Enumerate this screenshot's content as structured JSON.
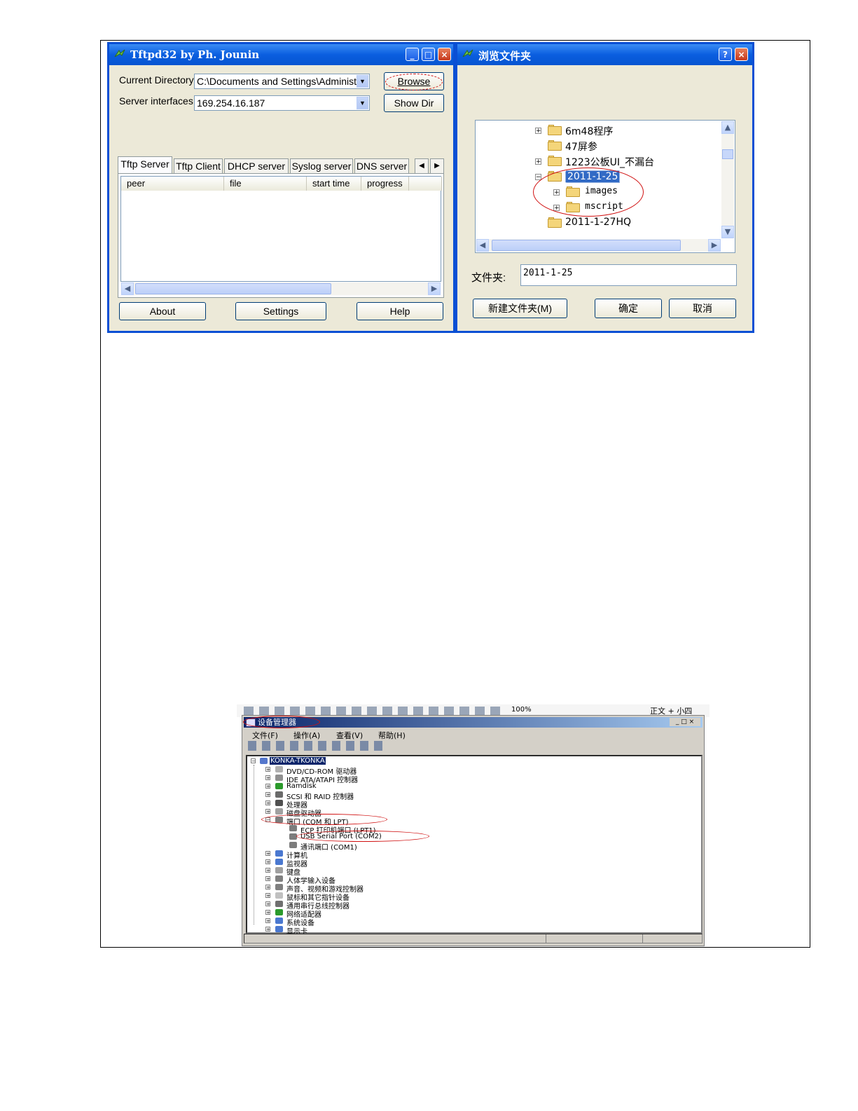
{
  "tftpd": {
    "title": "Tftpd32 by Ph. Jounin",
    "current_directory_label": "Current Directory",
    "current_directory_value": "C:\\Documents and Settings\\Administra",
    "browse_label": "Browse",
    "server_interfaces_label": "Server interfaces",
    "server_interfaces_value": "169.254.16.187",
    "show_dir_label": "Show Dir",
    "tabs": [
      "Tftp Server",
      "Tftp Client",
      "DHCP server",
      "Syslog server",
      "DNS server"
    ],
    "columns": [
      "peer",
      "file",
      "start time",
      "progress"
    ],
    "about_label": "About",
    "settings_label": "Settings",
    "help_label": "Help"
  },
  "browse_dialog": {
    "title": "浏览文件夹",
    "help_btn": "?",
    "close_btn": "×",
    "tree": [
      {
        "label": "6m48程序",
        "expand": "+"
      },
      {
        "label": "47屏参",
        "expand": ""
      },
      {
        "label": "1223公板UI_不漏台",
        "expand": "+"
      },
      {
        "label": "2011-1-25",
        "expand": "−"
      },
      {
        "label": "images",
        "expand": "+"
      },
      {
        "label": "mscript",
        "expand": "+"
      },
      {
        "label": "2011-1-27HQ",
        "expand": ""
      }
    ],
    "folder_label": "文件夹:",
    "folder_value": "2011-1-25",
    "new_folder_label": "新建文件夹(M)",
    "ok_label": "确定",
    "cancel_label": "取消"
  },
  "device_manager": {
    "toolbar_zoom": "100%",
    "toolbar_style": "正文 + 小四",
    "title": "设备管理器",
    "menu": [
      "文件(F)",
      "操作(A)",
      "查看(V)",
      "帮助(H)"
    ],
    "root": "KONKA-TKONKA",
    "items": [
      "DVD/CD-ROM 驱动器",
      "IDE ATA/ATAPI 控制器",
      "Ramdisk",
      "SCSI 和 RAID 控制器",
      "处理器",
      "磁盘驱动器",
      "端口 (COM 和 LPT)",
      "ECP 打印机端口 (LPT1)",
      "USB Serial Port (COM2)",
      "通讯端口 (COM1)",
      "计算机",
      "监视器",
      "键盘",
      "人体学输入设备",
      "声音、视频和游戏控制器",
      "鼠标和其它指针设备",
      "通用串行总线控制器",
      "网络适配器",
      "系统设备",
      "显示卡"
    ]
  },
  "colors": {
    "xp_title": "#0a5ee0",
    "annotation_red": "#d01010"
  }
}
